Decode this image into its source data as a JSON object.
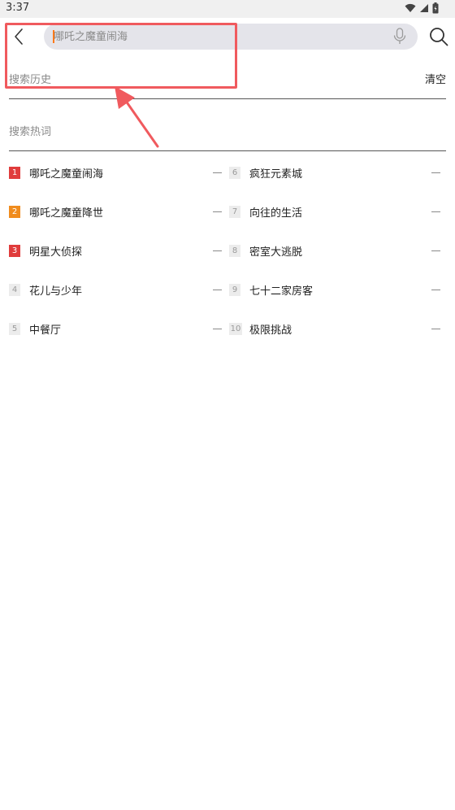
{
  "status_bar": {
    "time": "3:37"
  },
  "search": {
    "placeholder": "哪吒之魔童闹海",
    "value": ""
  },
  "history": {
    "title": "搜索历史",
    "clear_label": "清空"
  },
  "hot": {
    "title": "搜索热词",
    "items": [
      {
        "rank": "1",
        "label": "哪吒之魔童闹海"
      },
      {
        "rank": "2",
        "label": "哪吒之魔童降世"
      },
      {
        "rank": "3",
        "label": "明星大侦探"
      },
      {
        "rank": "4",
        "label": "花儿与少年"
      },
      {
        "rank": "5",
        "label": "中餐厅"
      },
      {
        "rank": "6",
        "label": "疯狂元素城"
      },
      {
        "rank": "7",
        "label": "向往的生活"
      },
      {
        "rank": "8",
        "label": "密室大逃脱"
      },
      {
        "rank": "9",
        "label": "七十二家房客"
      },
      {
        "rank": "10",
        "label": "极限挑战"
      }
    ]
  },
  "colors": {
    "rank1": "#e03c3c",
    "rank2": "#f08c1e",
    "rank3": "#e03c3c",
    "annotation": "#f05a5e",
    "cursor": "#ff7a1a"
  },
  "icons": {
    "back": "chevron-left-icon",
    "mic": "microphone-icon",
    "search": "search-icon",
    "wifi": "wifi-icon",
    "signal": "signal-icon",
    "battery": "battery-icon"
  }
}
